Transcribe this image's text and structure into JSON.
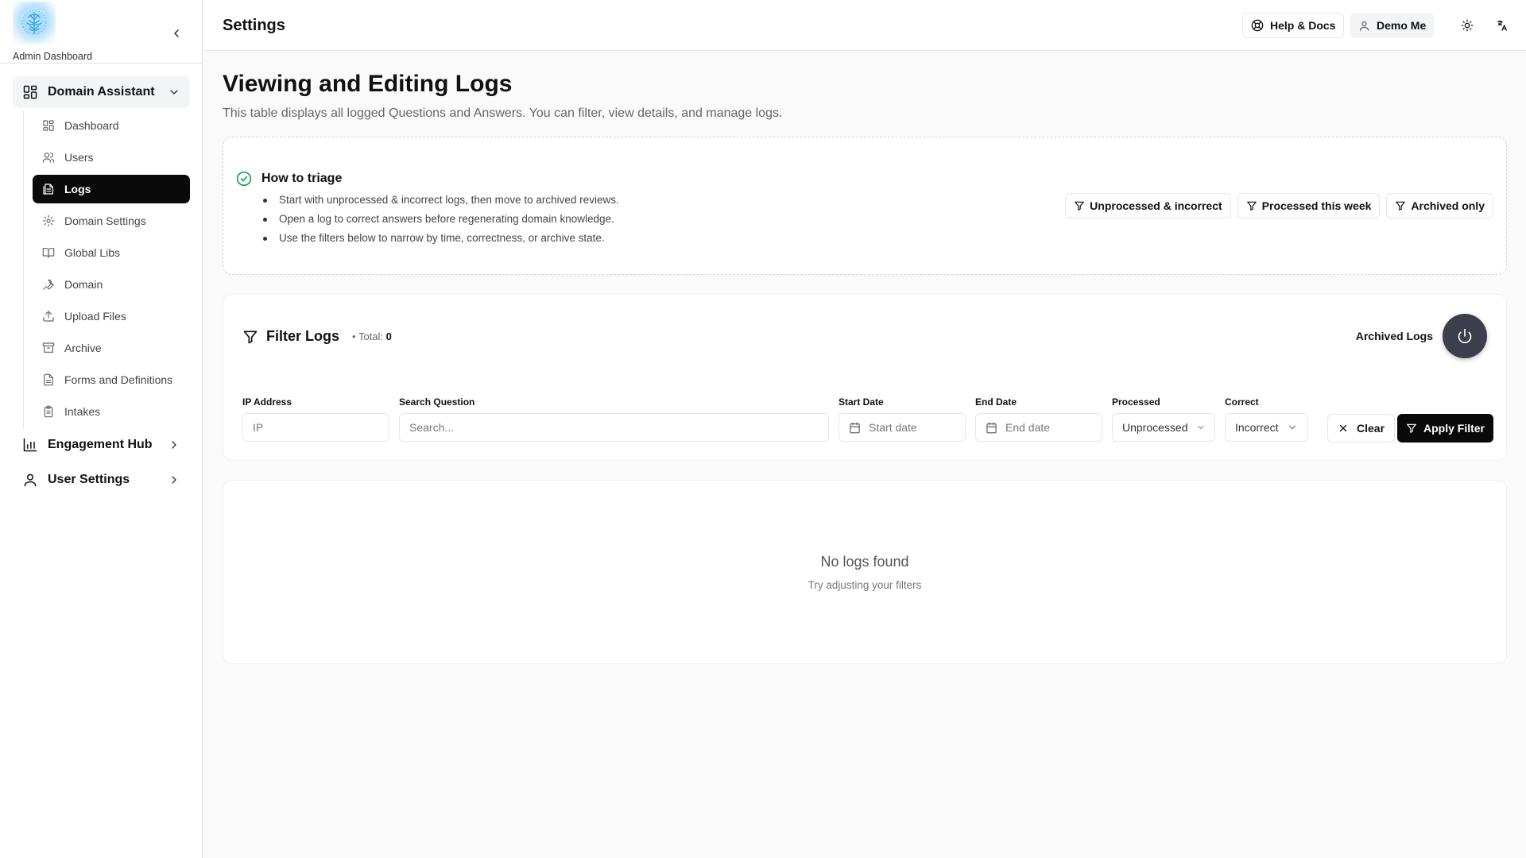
{
  "brand": {
    "label": "Admin Dashboard",
    "logo_icon": "brain-logo"
  },
  "sidebar": {
    "groups": [
      {
        "label": "Domain Assistant",
        "icon": "layout-grid-icon",
        "expanded": true
      },
      {
        "label": "Engagement Hub",
        "icon": "bar-chart-icon",
        "expanded": false
      },
      {
        "label": "User Settings",
        "icon": "user-icon",
        "expanded": false
      }
    ],
    "items": [
      {
        "label": "Dashboard",
        "icon": "layout-grid-icon"
      },
      {
        "label": "Users",
        "icon": "users-icon"
      },
      {
        "label": "Logs",
        "icon": "logs-icon",
        "active": true
      },
      {
        "label": "Domain Settings",
        "icon": "gear-icon"
      },
      {
        "label": "Global Libs",
        "icon": "book-icon"
      },
      {
        "label": "Domain",
        "icon": "wrench-icon"
      },
      {
        "label": "Upload Files",
        "icon": "upload-icon"
      },
      {
        "label": "Archive",
        "icon": "archive-icon"
      },
      {
        "label": "Forms and Definitions",
        "icon": "file-icon"
      },
      {
        "label": "Intakes",
        "icon": "clipboard-icon"
      }
    ]
  },
  "header": {
    "title": "Settings",
    "help_label": "Help & Docs",
    "user_label": "Demo Me"
  },
  "page": {
    "title": "Viewing and Editing Logs",
    "subtitle": "This table displays all logged Questions and Answers. You can filter, view details, and manage logs."
  },
  "triage": {
    "title": "How to triage",
    "tips": [
      "Start with unprocessed & incorrect logs, then move to archived reviews.",
      "Open a log to correct answers before regenerating domain knowledge.",
      "Use the filters below to narrow by time, correctness, or archive state."
    ],
    "presets": [
      "Unprocessed & incorrect",
      "Processed this week",
      "Archived only"
    ]
  },
  "filter": {
    "title": "Filter Logs",
    "total_label": "• Total:",
    "total_value": "0",
    "archived_label": "Archived Logs",
    "ip": {
      "label": "IP Address",
      "placeholder": "IP"
    },
    "search": {
      "label": "Search Question",
      "placeholder": "Search..."
    },
    "start": {
      "label": "Start Date",
      "placeholder": "Start date"
    },
    "end": {
      "label": "End Date",
      "placeholder": "End date"
    },
    "processed": {
      "label": "Processed",
      "value": "Unprocessed"
    },
    "correct": {
      "label": "Correct",
      "value": "Incorrect"
    },
    "clear_label": "Clear",
    "apply_label": "Apply Filter"
  },
  "empty": {
    "title": "No logs found",
    "subtitle": "Try adjusting your filters"
  },
  "colors": {
    "primary": "#0a0a0a",
    "success": "#16a34a",
    "power_button": "#3a3f4b"
  }
}
